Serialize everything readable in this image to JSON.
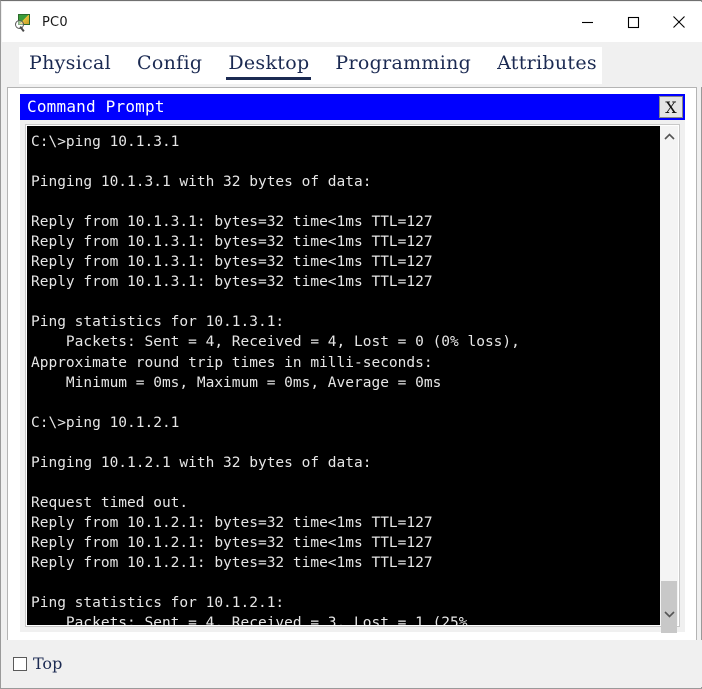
{
  "window": {
    "title": "PC0",
    "icon": "packet-tracer-pc-icon",
    "controls": {
      "minimize": "–",
      "maximize": "□",
      "close": "✕"
    }
  },
  "tabs": [
    {
      "label": "Physical",
      "active": false
    },
    {
      "label": "Config",
      "active": false
    },
    {
      "label": "Desktop",
      "active": true
    },
    {
      "label": "Programming",
      "active": false
    },
    {
      "label": "Attributes",
      "active": false
    }
  ],
  "command_prompt": {
    "title": "Command Prompt",
    "close_label": "X",
    "scrollbar": {
      "up_arrow": "⌃",
      "down_arrow": "⌄"
    },
    "terminal_text": "C:\\>ping 10.1.3.1\n\nPinging 10.1.3.1 with 32 bytes of data:\n\nReply from 10.1.3.1: bytes=32 time<1ms TTL=127\nReply from 10.1.3.1: bytes=32 time<1ms TTL=127\nReply from 10.1.3.1: bytes=32 time<1ms TTL=127\nReply from 10.1.3.1: bytes=32 time<1ms TTL=127\n\nPing statistics for 10.1.3.1:\n    Packets: Sent = 4, Received = 4, Lost = 0 (0% loss),\nApproximate round trip times in milli-seconds:\n    Minimum = 0ms, Maximum = 0ms, Average = 0ms\n\nC:\\>ping 10.1.2.1\n\nPinging 10.1.2.1 with 32 bytes of data:\n\nRequest timed out.\nReply from 10.1.2.1: bytes=32 time<1ms TTL=127\nReply from 10.1.2.1: bytes=32 time<1ms TTL=127\nReply from 10.1.2.1: bytes=32 time<1ms TTL=127\n\nPing statistics for 10.1.2.1:\n    Packets: Sent = 4, Received = 3, Lost = 1 (25%"
  },
  "footer": {
    "top_checkbox_label": "Top",
    "top_checkbox_checked": false
  },
  "colors": {
    "cmd_titlebar": "#0000ff",
    "terminal_bg": "#000000",
    "terminal_fg": "#e6e6e6",
    "tab_text": "#1b2a52",
    "window_chrome": "#f0f0f0"
  }
}
